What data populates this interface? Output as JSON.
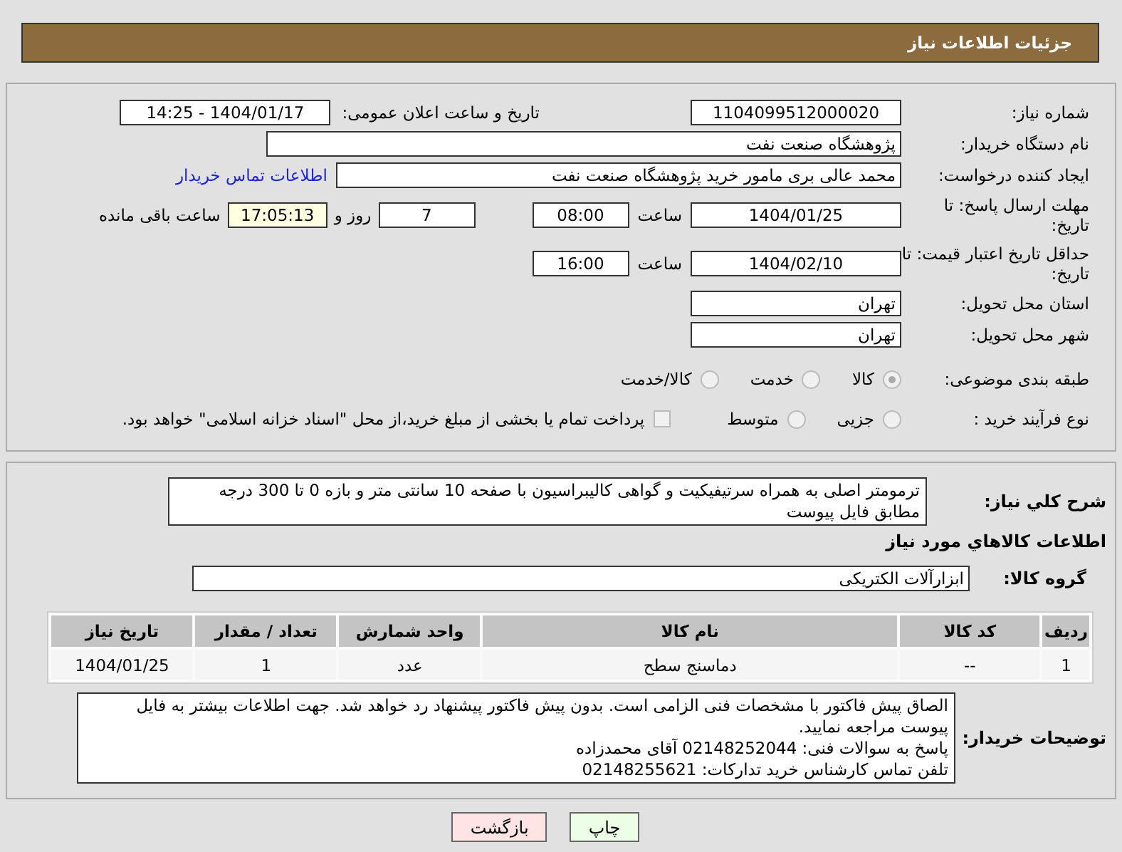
{
  "header": {
    "title": "جزئیات اطلاعات نیاز"
  },
  "details": {
    "need_number": {
      "label": "شماره نیاز:",
      "value": "1104099512000020"
    },
    "announce": {
      "label": "تاریخ و ساعت اعلان عمومی:",
      "value": "1404/01/17 - 14:25"
    },
    "buyer": {
      "label": "نام دستگاه خریدار:",
      "value": "پژوهشگاه صنعت نفت"
    },
    "creator": {
      "label": "ایجاد کننده درخواست:",
      "value": "محمد عالی بری مامور خرید پژوهشگاه صنعت نفت",
      "link": "اطلاعات تماس خریدار"
    },
    "deadline": {
      "label": "مهلت ارسال پاسخ: تا تاریخ:",
      "date": "1404/01/25",
      "time_label": "ساعت",
      "time": "08:00",
      "days": "7",
      "days_label": "روز و",
      "remaining": "17:05:13",
      "remaining_label": "ساعت باقی مانده"
    },
    "validity": {
      "label": "حداقل تاریخ اعتبار قیمت: تا تاریخ:",
      "date": "1404/02/10",
      "time_label": "ساعت",
      "time": "16:00"
    },
    "province": {
      "label": "استان محل تحویل:",
      "value": "تهران"
    },
    "city": {
      "label": "شهر محل تحویل:",
      "value": "تهران"
    },
    "category": {
      "label": "طبقه بندی موضوعی:",
      "options": [
        {
          "label": "کالا",
          "selected": true
        },
        {
          "label": "خدمت",
          "selected": false
        },
        {
          "label": "کالا/خدمت",
          "selected": false
        }
      ]
    },
    "process": {
      "label": "نوع فرآیند خرید :",
      "options": [
        {
          "label": "جزیی",
          "selected": false
        },
        {
          "label": "متوسط",
          "selected": false
        }
      ],
      "payment": {
        "label": "پرداخت تمام یا بخشی از مبلغ خرید،از محل \"اسناد خزانه اسلامی\" خواهد بود.",
        "checked": false
      }
    }
  },
  "need": {
    "label": "شرح کلي نیاز:",
    "value": "ترمومتر اصلی به همراه سرتیفیکیت و گواهی کالیبراسیون با صفحه 10 سانتی متر و بازه 0 تا 300 درجه مطابق فایل پیوست",
    "goods_heading": "اطلاعات کالاهاي مورد نیاز",
    "group": {
      "label": "گروه کالا:",
      "value": "ابزارآلات الکتریکی"
    },
    "table": {
      "columns": [
        "ردیف",
        "کد کالا",
        "نام کالا",
        "واحد شمارش",
        "تعداد / مقدار",
        "تاریخ نیاز"
      ],
      "rows": [
        [
          "1",
          "--",
          "دماسنج سطح",
          "عدد",
          "1",
          "1404/01/25"
        ]
      ]
    },
    "notes": {
      "label": "توضیحات خریدار:",
      "value": "الصاق پیش فاکتور با مشخصات فنی الزامی است. بدون پیش فاکتور پیشنهاد رد خواهد شد. جهت اطلاعات بیشتر به فایل پیوست مراجعه نمایید.\nپاسخ به سوالات فنی: 02148252044 آقای محمدزاده\nتلفن تماس کارشناس خرید تدارکات: 02148255621"
    }
  },
  "buttons": [
    {
      "label": "چاپ",
      "kind": "print"
    },
    {
      "label": "بازگشت",
      "kind": "back"
    }
  ]
}
